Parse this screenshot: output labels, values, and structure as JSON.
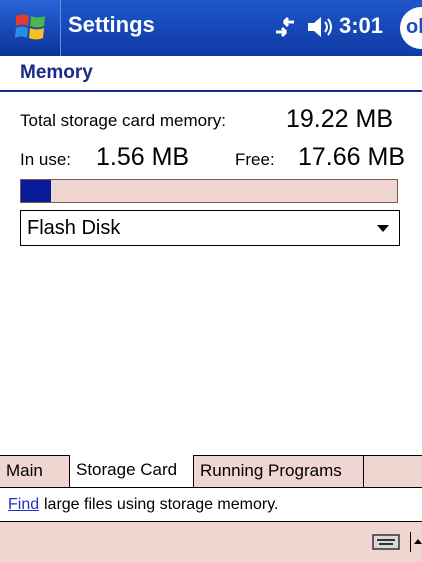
{
  "titlebar": {
    "title": "Settings",
    "clock": "3:01",
    "ok_label": "ok",
    "start_icon": "windows-flag-icon",
    "connectivity_icon": "connectivity-icon",
    "volume_icon": "speaker-icon"
  },
  "section": {
    "title": "Memory"
  },
  "memory": {
    "total_label": "Total storage card memory:",
    "total_value": "19.22 MB",
    "in_use_label": "In use:",
    "in_use_value": "1.56 MB",
    "free_label": "Free:",
    "free_value": "17.66 MB",
    "usage_fraction": 0.08
  },
  "dropdown": {
    "selected": "Flash Disk"
  },
  "tabs": [
    {
      "label": "Main"
    },
    {
      "label": "Storage Card"
    },
    {
      "label": "Running Programs"
    }
  ],
  "hint": {
    "link": "Find",
    "text": "large files using storage memory."
  },
  "colors": {
    "titlebar": "#1f57c9",
    "progress_fill": "#0a1b9a",
    "tab_bg": "#efd6d0",
    "link": "#1a34c8"
  }
}
